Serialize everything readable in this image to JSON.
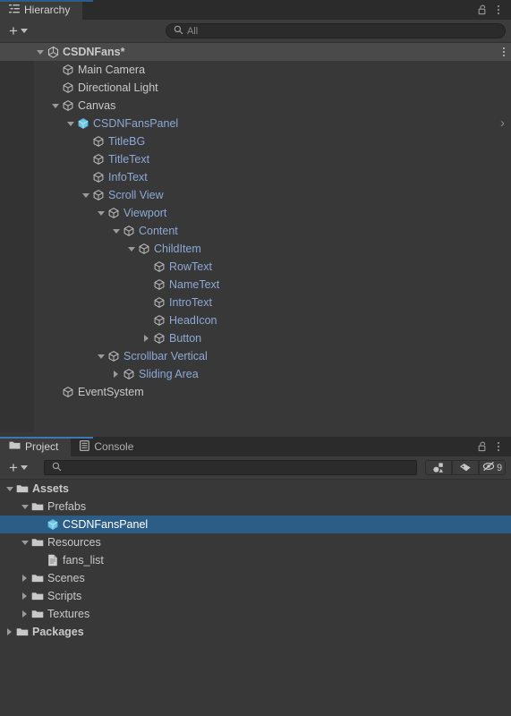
{
  "hierarchy_panel": {
    "tab": {
      "label": "Hierarchy",
      "icon": "hierarchy-list-icon"
    },
    "lock_icon": "lock-open-icon",
    "menu_icon": "kebab-menu-icon",
    "toolbar": {
      "add_label": "+",
      "dropdown_icon": "chevron-down-icon",
      "search_icon": "search-icon",
      "search_value": "",
      "search_placeholder": "All"
    },
    "rows": [
      {
        "label": "CSDNFans*",
        "depth": 0,
        "icon": "unity-scene-icon",
        "arrow": "down",
        "style": "scene",
        "end": "kebab"
      },
      {
        "label": "Main Camera",
        "depth": 1,
        "icon": "gameobject-icon",
        "arrow": "none",
        "style": "white",
        "end": "none"
      },
      {
        "label": "Directional Light",
        "depth": 1,
        "icon": "gameobject-icon",
        "arrow": "none",
        "style": "white",
        "end": "none"
      },
      {
        "label": "Canvas",
        "depth": 1,
        "icon": "gameobject-icon",
        "arrow": "down",
        "style": "white",
        "end": "none"
      },
      {
        "label": "CSDNFansPanel",
        "depth": 2,
        "icon": "prefab-cube-icon",
        "arrow": "down",
        "style": "blue",
        "end": "chevron"
      },
      {
        "label": "TitleBG",
        "depth": 3,
        "icon": "gameobject-icon",
        "arrow": "none",
        "style": "blue",
        "end": "none"
      },
      {
        "label": "TitleText",
        "depth": 3,
        "icon": "gameobject-icon",
        "arrow": "none",
        "style": "blue",
        "end": "none"
      },
      {
        "label": "InfoText",
        "depth": 3,
        "icon": "gameobject-icon",
        "arrow": "none",
        "style": "blue",
        "end": "none"
      },
      {
        "label": "Scroll View",
        "depth": 3,
        "icon": "gameobject-icon",
        "arrow": "down",
        "style": "blue",
        "end": "none"
      },
      {
        "label": "Viewport",
        "depth": 4,
        "icon": "gameobject-icon",
        "arrow": "down",
        "style": "blue",
        "end": "none"
      },
      {
        "label": "Content",
        "depth": 5,
        "icon": "gameobject-icon",
        "arrow": "down",
        "style": "blue",
        "end": "none"
      },
      {
        "label": "ChildItem",
        "depth": 6,
        "icon": "gameobject-icon",
        "arrow": "down",
        "style": "blue",
        "end": "none"
      },
      {
        "label": "RowText",
        "depth": 7,
        "icon": "gameobject-icon",
        "arrow": "none",
        "style": "blue",
        "end": "none"
      },
      {
        "label": "NameText",
        "depth": 7,
        "icon": "gameobject-icon",
        "arrow": "none",
        "style": "blue",
        "end": "none"
      },
      {
        "label": "IntroText",
        "depth": 7,
        "icon": "gameobject-icon",
        "arrow": "none",
        "style": "blue",
        "end": "none"
      },
      {
        "label": "HeadIcon",
        "depth": 7,
        "icon": "gameobject-icon",
        "arrow": "none",
        "style": "blue",
        "end": "none"
      },
      {
        "label": "Button",
        "depth": 7,
        "icon": "gameobject-icon",
        "arrow": "right",
        "style": "blue",
        "end": "none"
      },
      {
        "label": "Scrollbar Vertical",
        "depth": 4,
        "icon": "gameobject-icon",
        "arrow": "down",
        "style": "blue",
        "end": "none"
      },
      {
        "label": "Sliding Area",
        "depth": 5,
        "icon": "gameobject-icon",
        "arrow": "right",
        "style": "blue",
        "end": "none"
      },
      {
        "label": "EventSystem",
        "depth": 1,
        "icon": "gameobject-icon",
        "arrow": "none",
        "style": "white",
        "end": "none"
      }
    ]
  },
  "project_panel": {
    "tabs": [
      {
        "label": "Project",
        "icon": "folder-icon",
        "active": true
      },
      {
        "label": "Console",
        "icon": "console-icon",
        "active": false
      }
    ],
    "lock_icon": "lock-open-icon",
    "menu_icon": "kebab-menu-icon",
    "toolbar": {
      "add_label": "+",
      "dropdown_icon": "chevron-down-icon",
      "search_icon": "search-icon",
      "search_value": "",
      "search_placeholder": "",
      "filter_type_icon": "filter-by-type-icon",
      "filter_label_icon": "filter-by-label-icon",
      "hidden_count": "9",
      "hidden_icon": "eye-off-icon"
    },
    "rows": [
      {
        "label": "Assets",
        "depth": 0,
        "icon": "folder-open-icon",
        "arrow": "down",
        "style": "bold",
        "selected": false
      },
      {
        "label": "Prefabs",
        "depth": 1,
        "icon": "folder-open-icon",
        "arrow": "down",
        "style": "white",
        "selected": false
      },
      {
        "label": "CSDNFansPanel",
        "depth": 2,
        "icon": "prefab-cube-icon",
        "arrow": "none",
        "style": "selected",
        "selected": true
      },
      {
        "label": "Resources",
        "depth": 1,
        "icon": "folder-open-icon",
        "arrow": "down",
        "style": "white",
        "selected": false
      },
      {
        "label": "fans_list",
        "depth": 2,
        "icon": "text-file-icon",
        "arrow": "none",
        "style": "white",
        "selected": false
      },
      {
        "label": "Scenes",
        "depth": 1,
        "icon": "folder-icon",
        "arrow": "right",
        "style": "white",
        "selected": false
      },
      {
        "label": "Scripts",
        "depth": 1,
        "icon": "folder-icon",
        "arrow": "right",
        "style": "white",
        "selected": false
      },
      {
        "label": "Textures",
        "depth": 1,
        "icon": "folder-icon",
        "arrow": "right",
        "style": "white",
        "selected": false
      },
      {
        "label": "Packages",
        "depth": 0,
        "icon": "folder-icon",
        "arrow": "right",
        "style": "bold",
        "selected": false
      }
    ]
  },
  "colors": {
    "panel_bg": "#383838",
    "tabstrip_bg": "#2b2b2b",
    "toolbar_bg": "#3c3c3c",
    "selection_blue": "#2c5d87",
    "prefab_blue": "#8ca9d6",
    "accent_blue": "#3a79b8",
    "text": "#c9c9c9"
  }
}
